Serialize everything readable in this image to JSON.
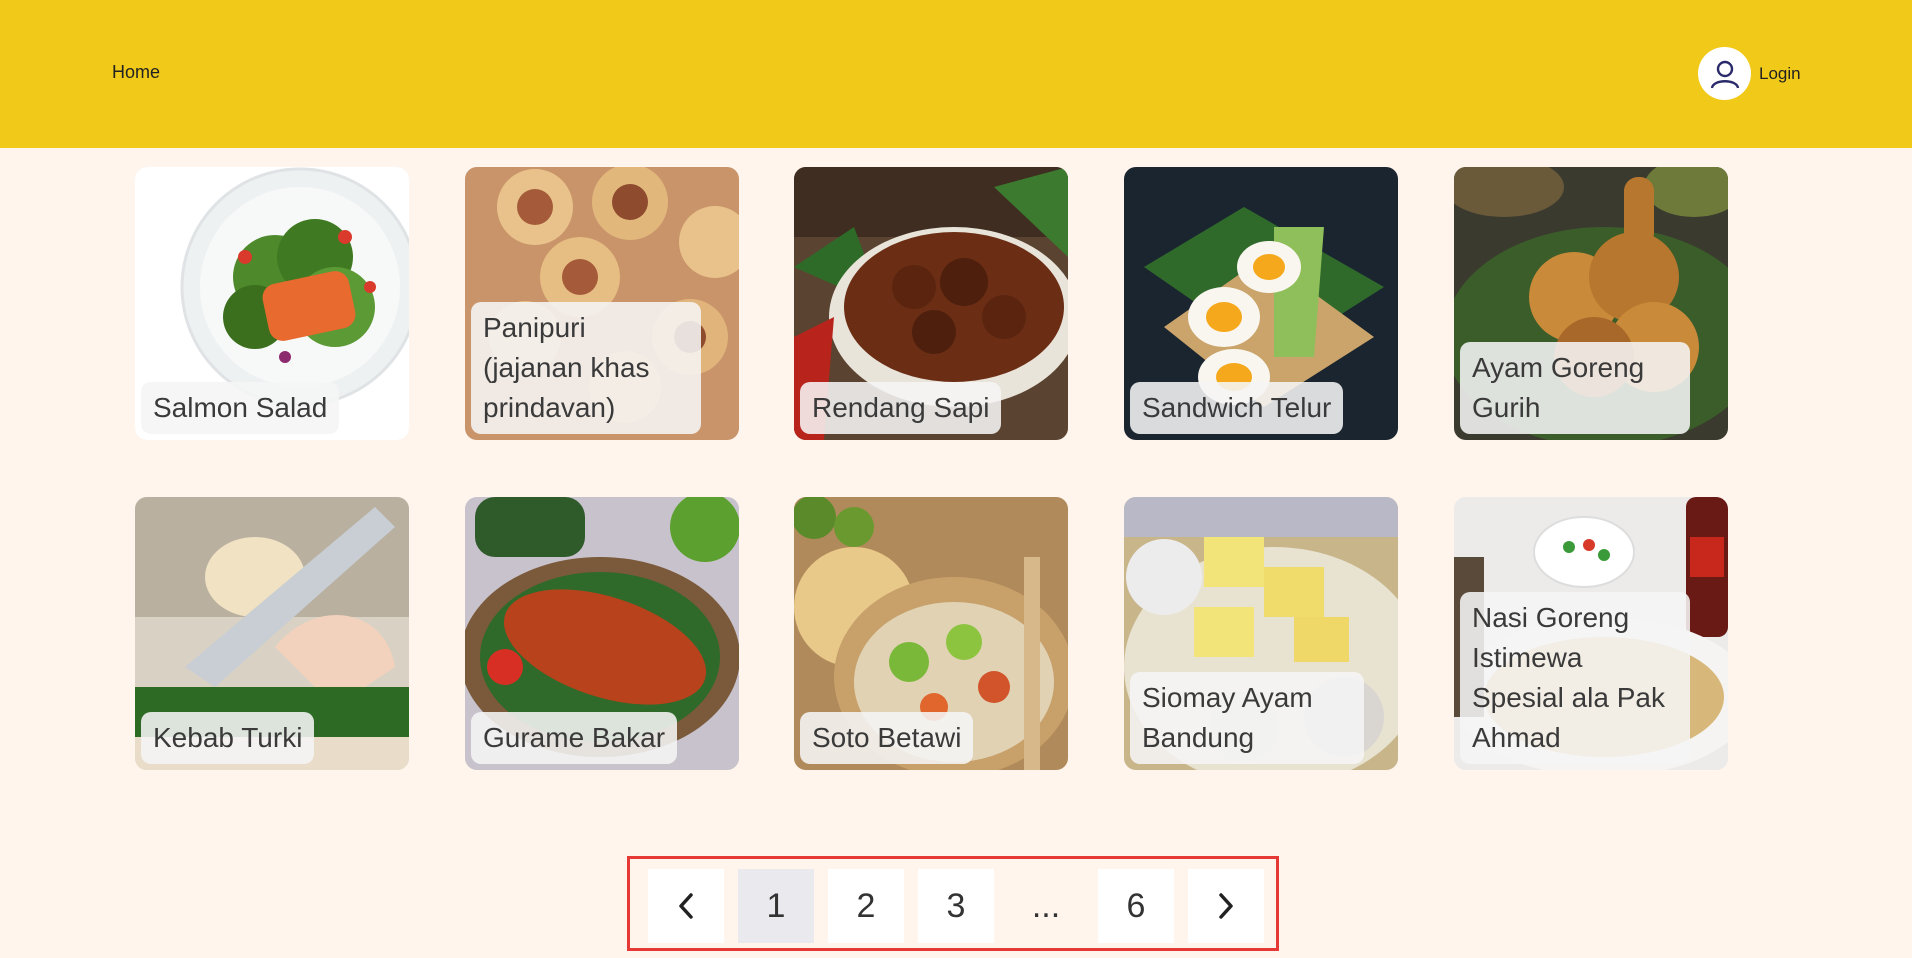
{
  "header": {
    "home_label": "Home",
    "login_label": "Login",
    "user_icon": "user-icon",
    "bg_color": "#f1c919"
  },
  "recipes": [
    {
      "name": "Salmon Salad"
    },
    {
      "name": "Panipuri (jajanan khas prindavan)"
    },
    {
      "name": "Rendang Sapi"
    },
    {
      "name": "Sandwich Telur"
    },
    {
      "name": "Ayam Goreng Gurih"
    },
    {
      "name": "Kebab Turki"
    },
    {
      "name": "Gurame Bakar"
    },
    {
      "name": "Soto Betawi"
    },
    {
      "name": "Siomay Ayam Bandung"
    },
    {
      "name": "Nasi Goreng Istimewa Spesial ala Pak Ahmad"
    }
  ],
  "pagination": {
    "prev_icon": "chevron-left-icon",
    "next_icon": "chevron-right-icon",
    "pages": [
      "1",
      "2",
      "3",
      "6"
    ],
    "ellipsis": "...",
    "current": "1"
  }
}
